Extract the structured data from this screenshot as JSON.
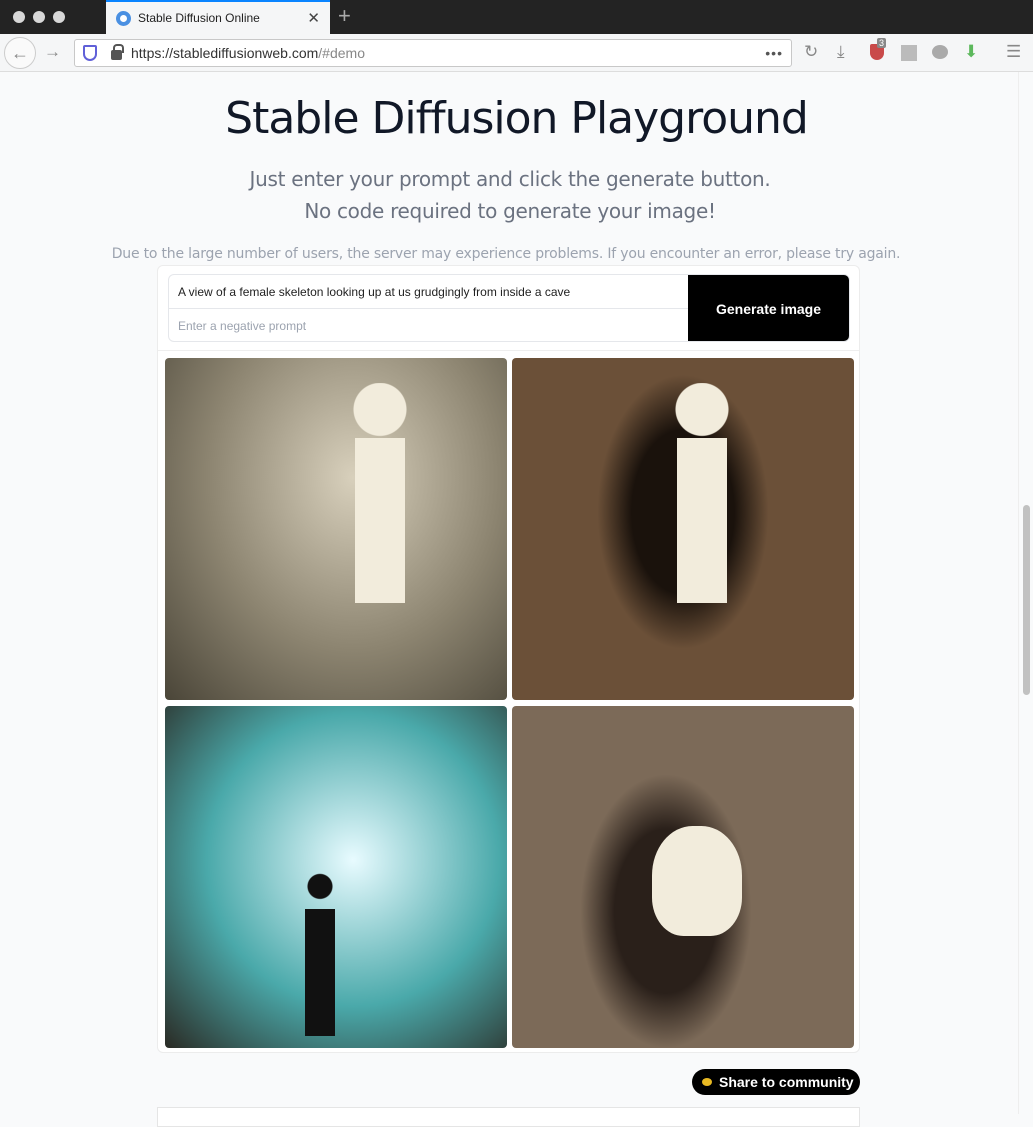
{
  "browser": {
    "tab_title": "Stable Diffusion Online",
    "url_host": "https://stablediffusionweb.com",
    "url_path": "/#demo",
    "ublock_count": "3"
  },
  "page": {
    "title": "Stable Diffusion Playground",
    "subtitle_line1": "Just enter your prompt and click the generate button.",
    "subtitle_line2": "No code required to generate your image!",
    "notice": "Due to the large number of users, the server may experience problems. If you encounter an error, please try again."
  },
  "form": {
    "prompt_value": "A view of a female skeleton looking up at us grudgingly from inside a cave",
    "negative_placeholder": "Enter a negative prompt",
    "generate_label": "Generate image"
  },
  "images": [
    {
      "colors": [
        "#d8d0bc",
        "#8c8470",
        "#4a4538"
      ]
    },
    {
      "colors": [
        "#a88a6a",
        "#6b5038",
        "#1a120c"
      ]
    },
    {
      "colors": [
        "#e8fbff",
        "#4aa9aa",
        "#2a2a24"
      ]
    },
    {
      "colors": [
        "#b8a48c",
        "#7c6a58",
        "#2a201a"
      ]
    }
  ],
  "share_label": "Share to community"
}
